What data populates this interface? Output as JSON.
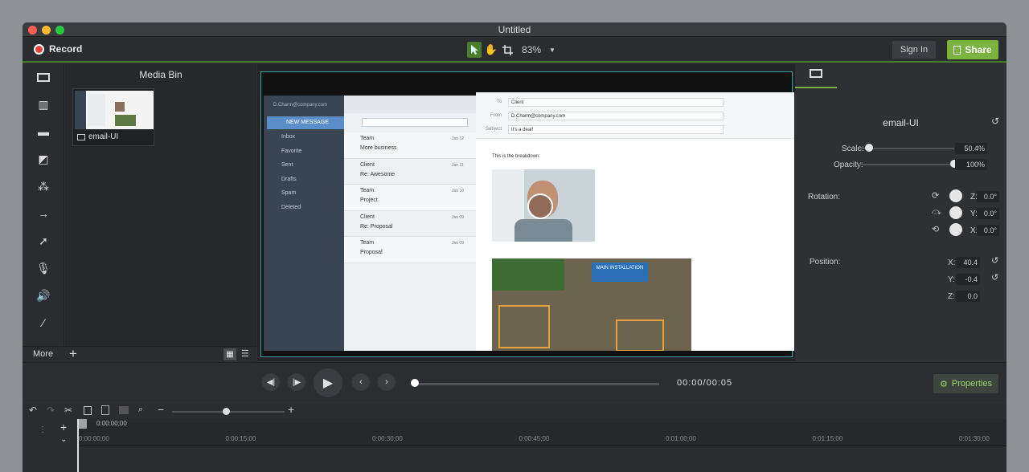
{
  "window": {
    "title": "Untitled"
  },
  "toolbar": {
    "record_label": "Record",
    "zoom": "83%",
    "signin_label": "Sign In",
    "share_label": "Share"
  },
  "media_bin": {
    "title": "Media Bin",
    "item_label": "email-UI",
    "more_label": "More"
  },
  "canvas": {
    "email": {
      "account": "D.Charm@company.com",
      "new_message": "NEW MESSAGE",
      "folders": [
        "Inbox",
        "Favorite",
        "Sent",
        "Drafts",
        "Spam",
        "Deleted"
      ],
      "messages": [
        {
          "from": "Team",
          "subject": "More business",
          "date": "Jan 12"
        },
        {
          "from": "Client",
          "subject": "Re: Awesome",
          "date": "Jan 11"
        },
        {
          "from": "Team",
          "subject": "Project",
          "date": "Jan 10"
        },
        {
          "from": "Client",
          "subject": "Re: Proposal",
          "date": "Jan 09"
        },
        {
          "from": "Team",
          "subject": "Proposal",
          "date": "Jan 09"
        }
      ],
      "to_label": "To",
      "to_value": "Client",
      "from_label": "From",
      "from_value": "D.Charm@company.com",
      "subject_label": "Subject",
      "subject_value": "It's a deal!",
      "body_text": "This is the breakdown:",
      "map_label": "MAIN INSTALLATION"
    }
  },
  "properties": {
    "title": "email-UI",
    "scale_label": "Scale:",
    "scale_value": "50.4%",
    "scale_level": 0.1,
    "opacity_label": "Opacity:",
    "opacity_value": "100%",
    "opacity_level": 1.0,
    "rotation_label": "Rotation:",
    "rot_z_label": "Z:",
    "rot_z": "0.0°",
    "rot_y_label": "Y:",
    "rot_y": "0.0°",
    "rot_x_label": "X:",
    "rot_x": "0.0°",
    "position_label": "Position:",
    "pos_x_label": "X:",
    "pos_x": "40.4",
    "pos_y_label": "Y:",
    "pos_y": "-0.4",
    "pos_z_label": "Z:",
    "pos_z": "0.0"
  },
  "playback": {
    "timecode": "00:00/00:05",
    "progress": 0.0,
    "properties_label": "Properties"
  },
  "timeline": {
    "playhead_time": "0:00:00;00",
    "ticks": [
      "0:00:00;00",
      "0:00:15;00",
      "0:00:30;00",
      "0:00:45;00",
      "0:01:00;00",
      "0:01:15;00",
      "0:01:30;00"
    ]
  },
  "colors": {
    "accent": "#7ab340",
    "record": "#e0433b"
  }
}
